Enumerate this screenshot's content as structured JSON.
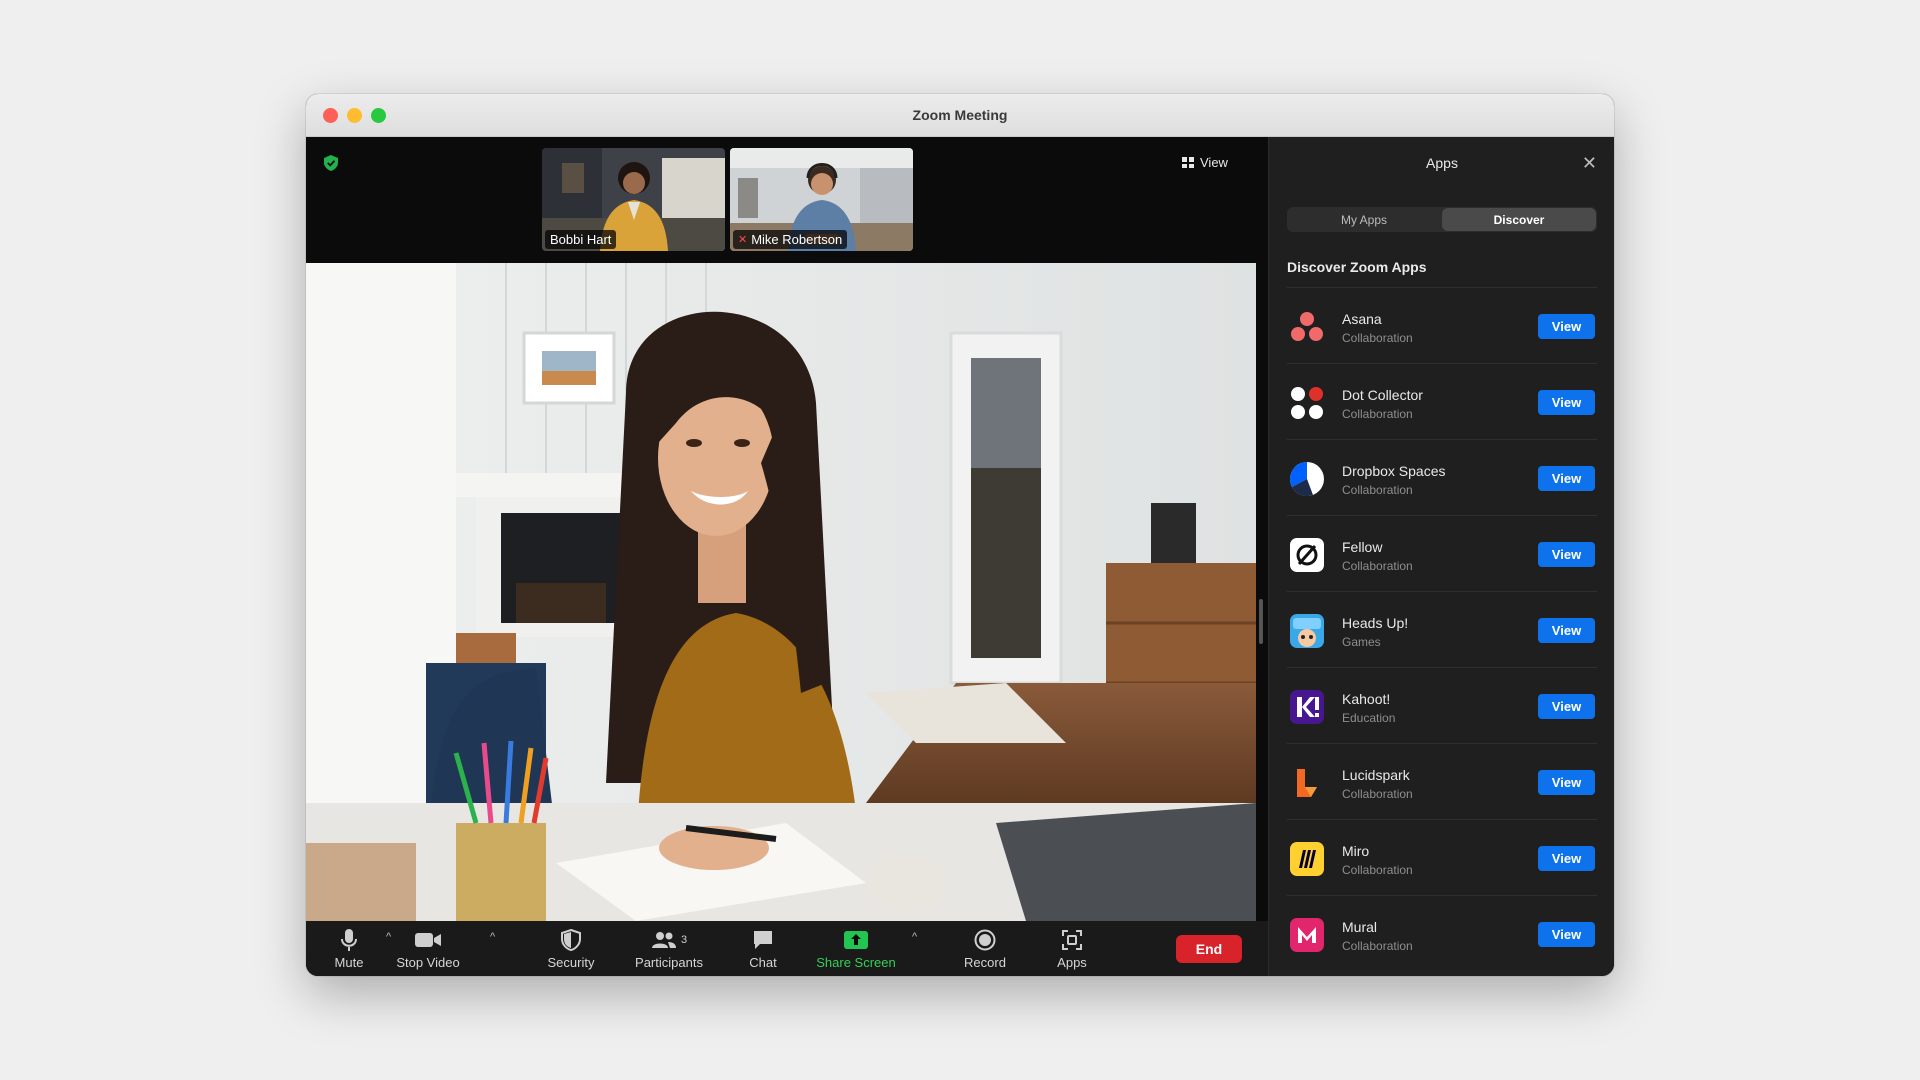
{
  "window": {
    "title": "Zoom Meeting"
  },
  "stage": {
    "view_label": "View",
    "thumbnails": [
      {
        "name": "Bobbi Hart",
        "muted": false
      },
      {
        "name": "Mike Robertson",
        "muted": true
      }
    ]
  },
  "toolbar": {
    "mute": "Mute",
    "stop_video": "Stop Video",
    "security": "Security",
    "participants": "Participants",
    "participants_count": "3",
    "chat": "Chat",
    "share_screen": "Share Screen",
    "record": "Record",
    "apps": "Apps",
    "end": "End"
  },
  "apps_panel": {
    "title": "Apps",
    "tabs": [
      "My Apps",
      "Discover"
    ],
    "active_tab": "Discover",
    "section_title": "Discover Zoom Apps",
    "view_label": "View",
    "apps": [
      {
        "name": "Asana",
        "category": "Collaboration",
        "icon": "asana-icon"
      },
      {
        "name": "Dot Collector",
        "category": "Collaboration",
        "icon": "dot-collector-icon"
      },
      {
        "name": "Dropbox Spaces",
        "category": "Collaboration",
        "icon": "dropbox-spaces-icon"
      },
      {
        "name": "Fellow",
        "category": "Collaboration",
        "icon": "fellow-icon"
      },
      {
        "name": "Heads Up!",
        "category": "Games",
        "icon": "heads-up-icon"
      },
      {
        "name": "Kahoot!",
        "category": "Education",
        "icon": "kahoot-icon"
      },
      {
        "name": "Lucidspark",
        "category": "Collaboration",
        "icon": "lucidspark-icon"
      },
      {
        "name": "Miro",
        "category": "Collaboration",
        "icon": "miro-icon"
      },
      {
        "name": "Mural",
        "category": "Collaboration",
        "icon": "mural-icon"
      }
    ]
  },
  "colors": {
    "accent_blue": "#0e72ed",
    "end_red": "#d8232a",
    "share_green": "#34d058"
  }
}
